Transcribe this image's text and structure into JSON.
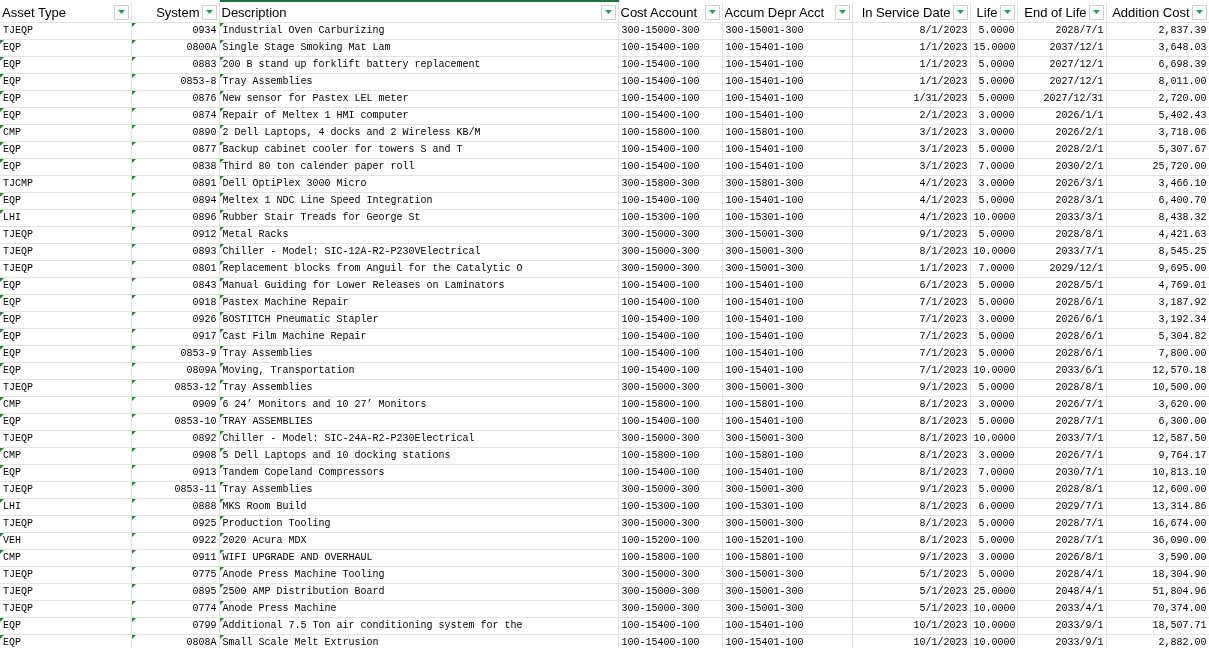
{
  "table": {
    "columns": [
      {
        "label": "Asset Type",
        "selected": false
      },
      {
        "label": "System",
        "selected": false,
        "marked": true
      },
      {
        "label": "Description",
        "selected": true,
        "marked": true
      },
      {
        "label": "Cost Account",
        "selected": false,
        "marked": false
      },
      {
        "label": "Accum Depr Acct",
        "selected": false,
        "marked": false
      },
      {
        "label": "In Service Date",
        "selected": false,
        "marked": false
      },
      {
        "label": "Life",
        "selected": false,
        "marked": false
      },
      {
        "label": "End of Life",
        "selected": false,
        "marked": false
      },
      {
        "label": "Addition Cost",
        "selected": false,
        "marked": false
      }
    ],
    "rows": [
      {
        "marked": false,
        "cells": [
          "TJEQP",
          "0934",
          "Industrial Oven Carburizing",
          "300-15000-300",
          "300-15001-300",
          "8/1/2023",
          "5.0000",
          "2028/7/1",
          "2,837.39"
        ]
      },
      {
        "marked": true,
        "cells": [
          "EQP",
          "0800A",
          "Single Stage Smoking Mat Lam",
          "100-15400-100",
          "100-15401-100",
          "1/1/2023",
          "15.0000",
          "2037/12/1",
          "3,648.03"
        ]
      },
      {
        "marked": true,
        "cells": [
          "EQP",
          "0883",
          "200 B stand up forklift battery replacement",
          "100-15400-100",
          "100-15401-100",
          "1/1/2023",
          "5.0000",
          "2027/12/1",
          "6,698.39"
        ]
      },
      {
        "marked": true,
        "cells": [
          "EQP",
          "0853-8",
          "Tray Assemblies",
          "100-15400-100",
          "100-15401-100",
          "1/1/2023",
          "5.0000",
          "2027/12/1",
          "8,011.00"
        ]
      },
      {
        "marked": true,
        "cells": [
          "EQP",
          "0876",
          "New sensor for Pastex LEL meter",
          "100-15400-100",
          "100-15401-100",
          "1/31/2023",
          "5.0000",
          "2027/12/31",
          "2,720.00"
        ]
      },
      {
        "marked": true,
        "cells": [
          "EQP",
          "0874",
          "Repair of Meltex 1 HMI computer",
          "100-15400-100",
          "100-15401-100",
          "2/1/2023",
          "3.0000",
          "2026/1/1",
          "5,402.43"
        ]
      },
      {
        "marked": true,
        "cells": [
          "CMP",
          "0890",
          "2 Dell Laptops, 4 docks and 2 Wireless KB/M",
          "100-15800-100",
          "100-15801-100",
          "3/1/2023",
          "3.0000",
          "2026/2/1",
          "3,718.06"
        ]
      },
      {
        "marked": true,
        "cells": [
          "EQP",
          "0877",
          "Backup cabinet cooler for towers S and T",
          "100-15400-100",
          "100-15401-100",
          "3/1/2023",
          "5.0000",
          "2028/2/1",
          "5,307.67"
        ]
      },
      {
        "marked": true,
        "cells": [
          "EQP",
          "0838",
          "Third 80 ton calender paper roll",
          "100-15400-100",
          "100-15401-100",
          "3/1/2023",
          "7.0000",
          "2030/2/1",
          "25,720.00"
        ]
      },
      {
        "marked": false,
        "cells": [
          "TJCMP",
          "0891",
          "Dell OptiPlex 3000 Micro",
          "300-15800-300",
          "300-15801-300",
          "4/1/2023",
          "3.0000",
          "2026/3/1",
          "3,466.10"
        ]
      },
      {
        "marked": true,
        "cells": [
          "EQP",
          "0894",
          "Meltex 1 NDC Line Speed Integration",
          "100-15400-100",
          "100-15401-100",
          "4/1/2023",
          "5.0000",
          "2028/3/1",
          "6,400.70"
        ]
      },
      {
        "marked": true,
        "cells": [
          "LHI",
          "0896",
          "Rubber Stair Treads for George St",
          "100-15300-100",
          "100-15301-100",
          "4/1/2023",
          "10.0000",
          "2033/3/1",
          "8,438.32"
        ]
      },
      {
        "marked": false,
        "cells": [
          "TJEQP",
          "0912",
          "Metal Racks",
          "300-15000-300",
          "300-15001-300",
          "9/1/2023",
          "5.0000",
          "2028/8/1",
          "4,421.63"
        ]
      },
      {
        "marked": false,
        "cells": [
          "TJEQP",
          "0893",
          "Chiller - Model: SIC-12A-R2-P230VElectrical",
          "300-15000-300",
          "300-15001-300",
          "8/1/2023",
          "10.0000",
          "2033/7/1",
          "8,545.25"
        ]
      },
      {
        "marked": false,
        "cells": [
          "TJEQP",
          "0801",
          "Replacement blocks from Anguil for the Catalytic O",
          "300-15000-300",
          "300-15001-300",
          "1/1/2023",
          "7.0000",
          "2029/12/1",
          "9,695.00"
        ]
      },
      {
        "marked": true,
        "cells": [
          "EQP",
          "0843",
          "Manual Guiding for Lower Releases on Laminators",
          "100-15400-100",
          "100-15401-100",
          "6/1/2023",
          "5.0000",
          "2028/5/1",
          "4,769.01"
        ]
      },
      {
        "marked": true,
        "cells": [
          "EQP",
          "0918",
          "Pastex Machine Repair",
          "100-15400-100",
          "100-15401-100",
          "7/1/2023",
          "5.0000",
          "2028/6/1",
          "3,187.92"
        ]
      },
      {
        "marked": true,
        "cells": [
          "EQP",
          "0926",
          "BOSTITCH Pneumatic Stapler",
          "100-15400-100",
          "100-15401-100",
          "7/1/2023",
          "3.0000",
          "2026/6/1",
          "3,192.34"
        ]
      },
      {
        "marked": true,
        "cells": [
          "EQP",
          "0917",
          "Cast Film Machine Repair",
          "100-15400-100",
          "100-15401-100",
          "7/1/2023",
          "5.0000",
          "2028/6/1",
          "5,304.82"
        ]
      },
      {
        "marked": true,
        "cells": [
          "EQP",
          "0853-9",
          "Tray Assemblies",
          "100-15400-100",
          "100-15401-100",
          "7/1/2023",
          "5.0000",
          "2028/6/1",
          "7,800.00"
        ]
      },
      {
        "marked": true,
        "cells": [
          "EQP",
          "0809A",
          "Moving, Transportation",
          "100-15400-100",
          "100-15401-100",
          "7/1/2023",
          "10.0000",
          "2033/6/1",
          "12,570.18"
        ]
      },
      {
        "marked": false,
        "cells": [
          "TJEQP",
          "0853-12",
          "Tray Assemblies",
          "300-15000-300",
          "300-15001-300",
          "9/1/2023",
          "5.0000",
          "2028/8/1",
          "10,500.00"
        ]
      },
      {
        "marked": true,
        "cells": [
          "CMP",
          "0909",
          "6 24’ Monitors and 10 27’ Monitors",
          "100-15800-100",
          "100-15801-100",
          "8/1/2023",
          "3.0000",
          "2026/7/1",
          "3,620.00"
        ]
      },
      {
        "marked": true,
        "cells": [
          "EQP",
          "0853-10",
          "TRAY ASSEMBLIES",
          "100-15400-100",
          "100-15401-100",
          "8/1/2023",
          "5.0000",
          "2028/7/1",
          "6,300.00"
        ]
      },
      {
        "marked": false,
        "cells": [
          "TJEQP",
          "0892",
          "Chiller - Model: SIC-24A-R2-P230Electrical",
          "300-15000-300",
          "300-15001-300",
          "8/1/2023",
          "10.0000",
          "2033/7/1",
          "12,587.50"
        ]
      },
      {
        "marked": true,
        "cells": [
          "CMP",
          "0908",
          "5 Dell Laptops and 10 docking stations",
          "100-15800-100",
          "100-15801-100",
          "8/1/2023",
          "3.0000",
          "2026/7/1",
          "9,764.17"
        ]
      },
      {
        "marked": true,
        "cells": [
          "EQP",
          "0913",
          "Tandem Copeland Compressors",
          "100-15400-100",
          "100-15401-100",
          "8/1/2023",
          "7.0000",
          "2030/7/1",
          "10,813.10"
        ]
      },
      {
        "marked": false,
        "cells": [
          "TJEQP",
          "0853-11",
          "Tray Assemblies",
          "300-15000-300",
          "300-15001-300",
          "9/1/2023",
          "5.0000",
          "2028/8/1",
          "12,600.00"
        ]
      },
      {
        "marked": true,
        "cells": [
          "LHI",
          "0888",
          "MKS Room Build",
          "100-15300-100",
          "100-15301-100",
          "8/1/2023",
          "6.0000",
          "2029/7/1",
          "13,314.86"
        ]
      },
      {
        "marked": false,
        "cells": [
          "TJEQP",
          "0925",
          "Production Tooling",
          "300-15000-300",
          "300-15001-300",
          "8/1/2023",
          "5.0000",
          "2028/7/1",
          "16,674.00"
        ]
      },
      {
        "marked": true,
        "cells": [
          "VEH",
          "0922",
          "2020 Acura MDX",
          "100-15200-100",
          "100-15201-100",
          "8/1/2023",
          "5.0000",
          "2028/7/1",
          "36,090.00"
        ]
      },
      {
        "marked": true,
        "cells": [
          "CMP",
          "0911",
          "WIFI UPGRADE AND OVERHAUL",
          "100-15800-100",
          "100-15801-100",
          "9/1/2023",
          "3.0000",
          "2026/8/1",
          "3,590.00"
        ]
      },
      {
        "marked": false,
        "cells": [
          "TJEQP",
          "0775",
          "Anode Press Machine Tooling",
          "300-15000-300",
          "300-15001-300",
          "5/1/2023",
          "5.0000",
          "2028/4/1",
          "18,304.90"
        ]
      },
      {
        "marked": false,
        "cells": [
          "TJEQP",
          "0895",
          "2500 AMP Distribution Board",
          "300-15000-300",
          "300-15001-300",
          "5/1/2023",
          "25.0000",
          "2048/4/1",
          "51,804.96"
        ]
      },
      {
        "marked": false,
        "cells": [
          "TJEQP",
          "0774",
          "Anode Press Machine",
          "300-15000-300",
          "300-15001-300",
          "5/1/2023",
          "10.0000",
          "2033/4/1",
          "70,374.00"
        ]
      },
      {
        "marked": true,
        "cells": [
          "EQP",
          "0799",
          "Additional 7.5 Ton air conditioning system for the",
          "100-15400-100",
          "100-15401-100",
          "10/1/2023",
          "10.0000",
          "2033/9/1",
          "18,507.71"
        ]
      },
      {
        "marked": true,
        "cells": [
          "EQP",
          "0808A",
          "Small Scale Melt Extrusion",
          "100-15400-100",
          "100-15401-100",
          "10/1/2023",
          "10.0000",
          "2033/9/1",
          "2,882.00"
        ]
      }
    ]
  }
}
